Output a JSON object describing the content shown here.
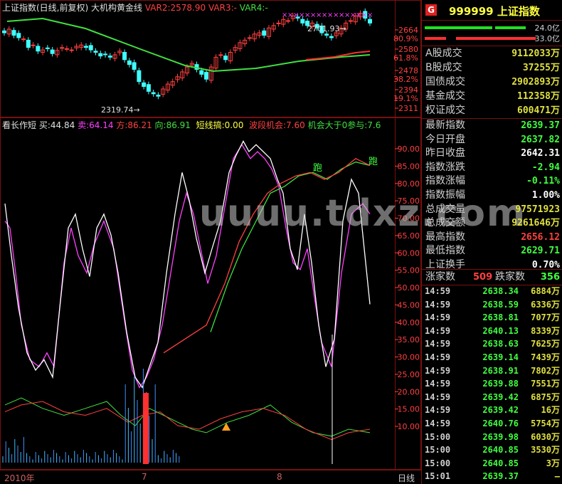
{
  "chart": {
    "title": "上证指数(日线,前复权) 大机构黄金线",
    "var2": "VAR2:2578.90",
    "var3": "VAR3:-",
    "var4": "VAR4:-",
    "high_marker": "2701.93",
    "low_marker": "2319.74",
    "price_axis": [
      "2664",
      "80.9%",
      "2580",
      "61.8%",
      "2478",
      "38.2%",
      "2394",
      "19.1%",
      "2311"
    ],
    "indicator": {
      "name": "看长作短",
      "buy": "买:44.84",
      "sell": "卖:64.14",
      "fang": "方:86.21",
      "xiang": "向:86.91",
      "short": "短线搞:0.00",
      "wave": "波段机会:7.60",
      "chance": "机会大于0参与:7.6"
    },
    "ind_axis": [
      "90.00",
      "85.00",
      "80.00",
      "75.00",
      "70.00",
      "65.00",
      "60.00",
      "55.00",
      "50.00",
      "45.00",
      "40.00",
      "35.00",
      "30.00",
      "25.00",
      "20.00",
      "15.00",
      "10.00"
    ],
    "run_label": "跑",
    "x_labels": [
      "2010年",
      "7",
      "8"
    ],
    "period": "日线",
    "watermark": "uuuu.tdxz.com"
  },
  "side": {
    "g_badge": "G",
    "code": "999999",
    "name": "上证指数",
    "bar1": "24.0亿",
    "bar2": "33.0亿",
    "stats": [
      {
        "label": "A股成交",
        "value": "9112033万"
      },
      {
        "label": "B股成交",
        "value": "37255万"
      },
      {
        "label": "国债成交",
        "value": "2902893万"
      },
      {
        "label": "基金成交",
        "value": "112358万"
      },
      {
        "label": "权证成交",
        "value": "600471万"
      }
    ],
    "quote": [
      {
        "label": "最新指数",
        "value": "2639.37",
        "color": "#40ff40"
      },
      {
        "label": "今日开盘",
        "value": "2637.82",
        "color": "#40ff40"
      },
      {
        "label": "昨日收盘",
        "value": "2642.31",
        "color": "#ffffff"
      },
      {
        "label": "指数涨跌",
        "value": "-2.94",
        "color": "#40ff40"
      },
      {
        "label": "指数涨幅",
        "value": "-0.11%",
        "color": "#40ff40"
      },
      {
        "label": "指数振幅",
        "value": "1.00%",
        "color": "#ffffff"
      },
      {
        "label": "总成交量",
        "value": "97571923",
        "color": "#e0e040"
      },
      {
        "label": "总成交额",
        "value": "9261646万",
        "color": "#e0e040"
      },
      {
        "label": "最高指数",
        "value": "2656.12",
        "color": "#ff4040"
      },
      {
        "label": "最低指数",
        "value": "2629.71",
        "color": "#40ff40"
      },
      {
        "label": "上证换手",
        "value": "0.70%",
        "color": "#ffffff"
      }
    ],
    "up_label": "涨家数",
    "up_count": "509",
    "down_label": "跌家数",
    "down_count": "356",
    "ticks": [
      {
        "time": "14:59",
        "price": "2638.34",
        "vol": "6884万"
      },
      {
        "time": "14:59",
        "price": "2638.59",
        "vol": "6336万"
      },
      {
        "time": "14:59",
        "price": "2638.81",
        "vol": "7077万"
      },
      {
        "time": "14:59",
        "price": "2640.13",
        "vol": "8339万"
      },
      {
        "time": "14:59",
        "price": "2638.63",
        "vol": "7625万"
      },
      {
        "time": "14:59",
        "price": "2639.14",
        "vol": "7439万"
      },
      {
        "time": "14:59",
        "price": "2638.91",
        "vol": "7802万"
      },
      {
        "time": "14:59",
        "price": "2639.88",
        "vol": "7551万"
      },
      {
        "time": "14:59",
        "price": "2639.42",
        "vol": "6875万"
      },
      {
        "time": "14:59",
        "price": "2639.42",
        "vol": "16万"
      },
      {
        "time": "14:59",
        "price": "2640.76",
        "vol": "5754万"
      },
      {
        "time": "15:00",
        "price": "2639.98",
        "vol": "6030万"
      },
      {
        "time": "15:00",
        "price": "2640.85",
        "vol": "3530万"
      },
      {
        "time": "15:00",
        "price": "2640.85",
        "vol": "3万"
      },
      {
        "time": "15:01",
        "price": "2639.37",
        "vol": "—"
      }
    ]
  },
  "colors": {
    "up": "#ff4040",
    "down": "#40ffff",
    "ma_green": "#40e040",
    "ma_red": "#ff3030",
    "white_line": "#ffffff",
    "magenta_line": "#ff40ff"
  }
}
